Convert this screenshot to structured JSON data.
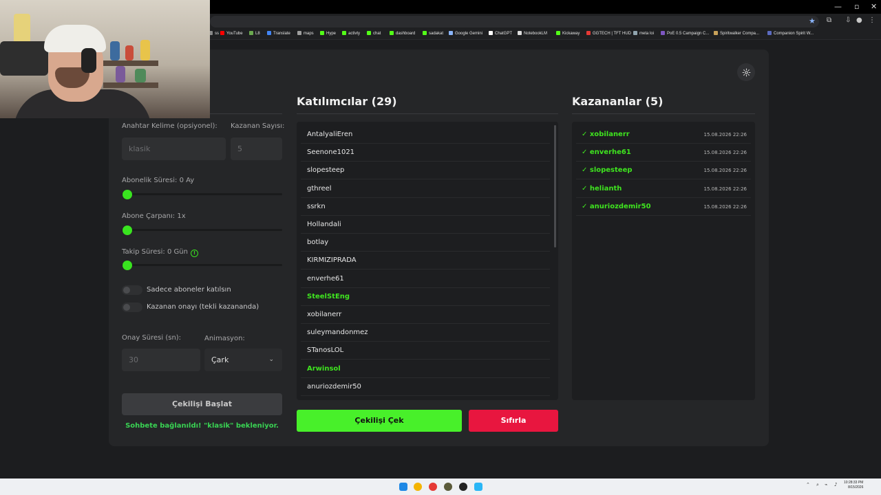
{
  "browser": {
    "bookmarks": [
      {
        "label": "ss",
        "color": "#888888"
      },
      {
        "label": "YouTube",
        "color": "#ff0000"
      },
      {
        "label": "L8",
        "color": "#6aa84f"
      },
      {
        "label": "Translate",
        "color": "#4285f4"
      },
      {
        "label": "maps",
        "color": "#9e9e9e"
      },
      {
        "label": "Hype",
        "color": "#53fc18"
      },
      {
        "label": "activty",
        "color": "#53fc18"
      },
      {
        "label": "chat",
        "color": "#53fc18"
      },
      {
        "label": "dashboard",
        "color": "#53fc18"
      },
      {
        "label": "sadakat",
        "color": "#53fc18"
      },
      {
        "label": "Google Gemini",
        "color": "#8ab4f8"
      },
      {
        "label": "ChatGPT",
        "color": "#ffffff"
      },
      {
        "label": "NotebookLM",
        "color": "#dddddd"
      },
      {
        "label": "Kickaway",
        "color": "#53fc18"
      },
      {
        "label": "GGTECH | TFT HUD",
        "color": "#e53935"
      },
      {
        "label": "meta loi",
        "color": "#90a4ae"
      },
      {
        "label": "PoE 0.5 Campaign C...",
        "color": "#7e57c2"
      },
      {
        "label": "Spiritwalker Compa...",
        "color": "#c8a15a"
      },
      {
        "label": "Companion Spirit W...",
        "color": "#5c6bc0"
      }
    ]
  },
  "settings": {
    "keyword_label": "Anahtar Kelime (opsiyonel):",
    "keyword_placeholder": "klasik",
    "winner_count_label": "Kazanan Sayısı:",
    "winner_count_value": "5",
    "sub_duration_label": "Abonelik Süresi: 0 Ay",
    "sub_duration_value": 0,
    "sub_multiplier_label": "Abone Çarpanı: 1x",
    "sub_multiplier_value": 0,
    "follow_duration_label": "Takip Süresi:  0  Gün",
    "follow_duration_value": 0,
    "subs_only_label": "Sadece aboneler katılsın",
    "subs_only_on": false,
    "winner_confirm_label": "Kazanan onayı (tekli kazananda)",
    "winner_confirm_on": false,
    "confirm_time_label": "Onay Süresi (sn):",
    "confirm_time_value": "30",
    "animation_label": "Animasyon:",
    "animation_value": "Çark",
    "start_button": "Çekilişi Başlat",
    "status_text": "Sohbete bağlanıldı! \"klasik\" bekleniyor."
  },
  "participants": {
    "title": "Katılımcılar (29)",
    "items": [
      {
        "name": "AntalyaliEren",
        "highlight": false
      },
      {
        "name": "Seenone1021",
        "highlight": false
      },
      {
        "name": "slopesteep",
        "highlight": false
      },
      {
        "name": "gthreel",
        "highlight": false
      },
      {
        "name": "ssrkn",
        "highlight": false
      },
      {
        "name": "Hollandali",
        "highlight": false
      },
      {
        "name": "botlay",
        "highlight": false
      },
      {
        "name": "KIRMIZIPRADA",
        "highlight": false
      },
      {
        "name": "enverhe61",
        "highlight": false
      },
      {
        "name": "SteelStEng",
        "highlight": true
      },
      {
        "name": "xobilanerr",
        "highlight": false
      },
      {
        "name": "suleymandonmez",
        "highlight": false
      },
      {
        "name": "STanosLOL",
        "highlight": false
      },
      {
        "name": "Arwinsol",
        "highlight": true
      },
      {
        "name": "anuriozdemir50",
        "highlight": false
      }
    ],
    "draw_button": "Çekilişi Çek",
    "reset_button": "Sıfırla"
  },
  "winners": {
    "title": "Kazananlar (5)",
    "items": [
      {
        "name": "✓ xobilanerr",
        "date": "15.08.2026 22:26"
      },
      {
        "name": "✓ enverhe61",
        "date": "15.08.2026 22:26"
      },
      {
        "name": "✓ slopesteep",
        "date": "15.08.2026 22:26"
      },
      {
        "name": "✓ helianth",
        "date": "15.08.2026 22:26"
      },
      {
        "name": "✓ anuriozdemir50",
        "date": "15.08.2026 22:26"
      }
    ]
  },
  "taskbar": {
    "time": "10:28:33 PM",
    "date": "8/15/2026"
  },
  "colors": {
    "accent_green": "#48f02a",
    "danger_red": "#e8163f",
    "card_bg": "#252628"
  }
}
